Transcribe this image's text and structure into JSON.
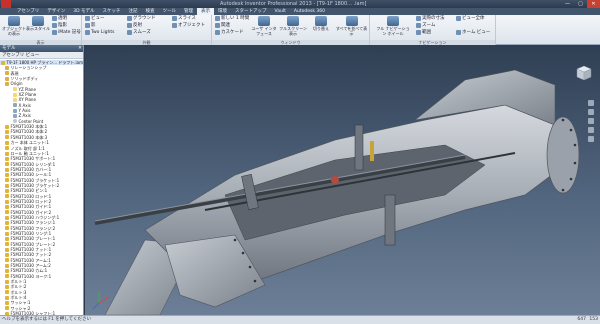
{
  "window": {
    "title": "Autodesk Inventor Professional 2013 - [T9-1F 1800... .iam]",
    "min": "—",
    "max": "▢",
    "close": "✕"
  },
  "tabs": [
    "アセンブリ",
    "デザイン",
    "3D モデル",
    "スケッチ",
    "注記",
    "検査",
    "ツール",
    "管理",
    "表示",
    "環境",
    "スタートアップ",
    "Vault",
    "Autodesk 360"
  ],
  "ribbon": {
    "vis": {
      "label": "表示",
      "b1": "オブジェクトの表示",
      "b2": "表示スタイル"
    },
    "vis_small": [
      "透明",
      "陰影",
      "iMate 記号"
    ],
    "appearance": {
      "label": "外観",
      "items": [
        "ビュー",
        "影",
        "Two Lights"
      ],
      "items2": [
        "グラウンド",
        "反射",
        "スムーズ"
      ],
      "items3": [
        "スライス",
        "オブジェクト"
      ]
    },
    "windows": {
      "label": "ウィンドウ",
      "items": [
        "ユーザ インタフェース",
        "フルスクリーン表示",
        "切り替え",
        "すべてを並べて表示"
      ],
      "small": [
        "新しい 1 時間",
        "関連",
        "カスケード"
      ]
    },
    "nav": {
      "label": "ナビゲーション",
      "items": [
        "フル ナビゲーション ホイール"
      ],
      "small": [
        "範囲",
        "ズーム",
        "ホーム ビュー",
        "実際の寸法",
        "ビュー全体"
      ]
    }
  },
  "sidebar": {
    "title": "モデル",
    "tool": "アセンブリ ビュー",
    "items": [
      {
        "label": "T9-1F 1800 HP ブライン... ドラフト.iam",
        "icon": "assembly-icon",
        "sel": true
      },
      {
        "label": "リレーションシップ",
        "icon": "folder-icon"
      },
      {
        "label": "表現",
        "icon": "folder-icon"
      },
      {
        "label": "ソリッドボディ",
        "icon": "folder-icon"
      },
      {
        "label": "Origin",
        "icon": "folder-icon"
      },
      {
        "label": "YZ Plane",
        "icon": "plane-icon"
      },
      {
        "label": "XZ Plane",
        "icon": "plane-icon"
      },
      {
        "label": "XY Plane",
        "icon": "plane-icon"
      },
      {
        "label": "X Axis",
        "icon": "axis-icon"
      },
      {
        "label": "Y Axis",
        "icon": "axis-icon"
      },
      {
        "label": "Z Axis",
        "icon": "axis-icon"
      },
      {
        "label": "Center Point",
        "icon": "point-icon"
      },
      {
        "label": "F5M3T1030 本体:1",
        "icon": "part-icon"
      },
      {
        "label": "F5M3T1030 本体:2",
        "icon": "part-icon"
      },
      {
        "label": "F5M3T1030 本体:3",
        "icon": "part-icon"
      },
      {
        "label": "カー 本体 ユニット:1",
        "icon": "part-icon"
      },
      {
        "label": "ノズル 取付 部 1:1",
        "icon": "part-icon"
      },
      {
        "label": "ロール 軸 ユニット:1",
        "icon": "part-icon"
      },
      {
        "label": "F5M3T1030 サポート:1",
        "icon": "part-icon"
      },
      {
        "label": "F5M3T1030 シリンダ:1",
        "icon": "part-icon"
      },
      {
        "label": "F5M3T1030 カバー:1",
        "icon": "part-icon"
      },
      {
        "label": "F5M3T1030 シール:1",
        "icon": "part-icon"
      },
      {
        "label": "F5M3T1030 ブラケット:1",
        "icon": "part-icon"
      },
      {
        "label": "F5M3T1030 ブラケット:2",
        "icon": "part-icon"
      },
      {
        "label": "F5M3T1030 ピン:1",
        "icon": "part-icon"
      },
      {
        "label": "F5M3T1030 ロッド:1",
        "icon": "part-icon"
      },
      {
        "label": "F5M3T1030 ロッド:2",
        "icon": "part-icon"
      },
      {
        "label": "F5M3T1030 ガイド:1",
        "icon": "part-icon"
      },
      {
        "label": "F5M3T1030 ガイド:2",
        "icon": "part-icon"
      },
      {
        "label": "F5M3T1030 ハウジング:1",
        "icon": "part-icon"
      },
      {
        "label": "F5M3T1030 フランジ:1",
        "icon": "part-icon"
      },
      {
        "label": "F5M3T1030 フランジ:2",
        "icon": "part-icon"
      },
      {
        "label": "F5M3T1030 リング:1",
        "icon": "part-icon"
      },
      {
        "label": "F5M3T1030 プレート:1",
        "icon": "part-icon"
      },
      {
        "label": "F5M3T1030 プレート:2",
        "icon": "part-icon"
      },
      {
        "label": "F5M3T1030 ナット:1",
        "icon": "part-icon"
      },
      {
        "label": "F5M3T1030 ナット:2",
        "icon": "part-icon"
      },
      {
        "label": "F5M3T1030 アーム:1",
        "icon": "part-icon"
      },
      {
        "label": "F5M3T1030 アーム:2",
        "icon": "part-icon"
      },
      {
        "label": "F5M3T1030 カム:1",
        "icon": "part-icon"
      },
      {
        "label": "F5M3T1030 ヨーク:1",
        "icon": "part-icon"
      },
      {
        "label": "ボルト:1",
        "icon": "part-icon"
      },
      {
        "label": "ボルト:2",
        "icon": "part-icon"
      },
      {
        "label": "ボルト:3",
        "icon": "part-icon"
      },
      {
        "label": "ボルト:4",
        "icon": "part-icon"
      },
      {
        "label": "ワッシャ:1",
        "icon": "part-icon"
      },
      {
        "label": "ワッシャ:2",
        "icon": "part-icon"
      },
      {
        "label": "F5M3T1030 シャフト:1",
        "icon": "part-icon"
      },
      {
        "label": "F5M3T1030 シャフト:2",
        "icon": "part-icon"
      }
    ]
  },
  "status": {
    "message": "ヘルプを表示するには F1 を押してください",
    "count1": "647",
    "count2": "153"
  },
  "colors": {
    "titlebar": "#2c3a4e",
    "ribbon": "#e6ebf1",
    "viewport_top": "#2f3f53",
    "viewport_bottom": "#6c7f96",
    "model_body": "#b7bcc3",
    "model_shadow": "#7b828b",
    "accent_red": "#c9302c"
  }
}
